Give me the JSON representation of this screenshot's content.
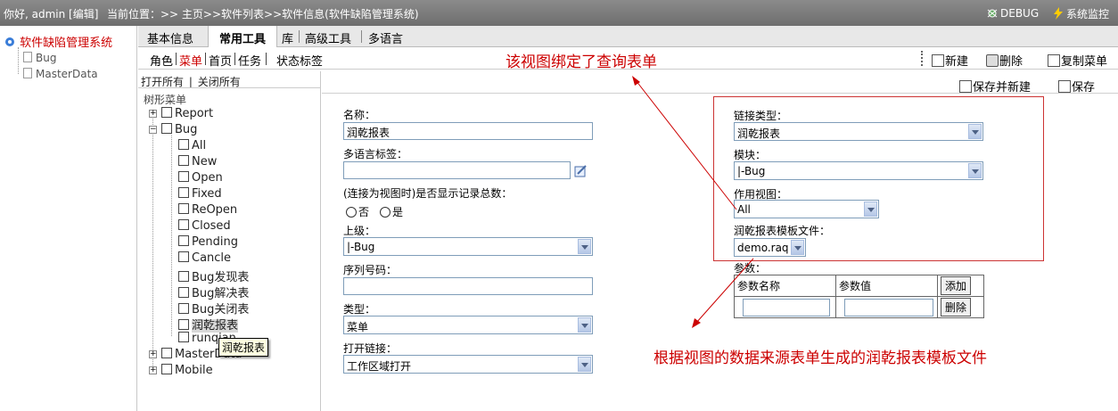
{
  "topbar": {
    "greeting": "你好, admin [编辑]",
    "location": "当前位置：>> 主页>>软件列表>>软件信息(软件缺陷管理系统)",
    "debug": "DEBUG",
    "monitor": "系统监控"
  },
  "leftnav": {
    "root": "软件缺陷管理系统",
    "items": [
      "Bug",
      "MasterData"
    ]
  },
  "tabs": [
    "基本信息",
    "常用工具",
    "库",
    "高级工具",
    "多语言"
  ],
  "subtabs": [
    "角色",
    "菜单",
    "首页",
    "任务",
    "状态标签"
  ],
  "toolbar": {
    "new": "新建",
    "delete": "删除",
    "copy_menu": "复制菜单",
    "save_new": "保存并新建",
    "save": "保存"
  },
  "tree": {
    "open_all": "打开所有",
    "close_all": "关闭所有",
    "title": "树形菜单",
    "nodes": [
      "Report",
      "Bug",
      "MasterData",
      "Mobile"
    ],
    "bug_children": [
      "All",
      "New",
      "Open",
      "Fixed",
      "ReOpen",
      "Closed",
      "Pending",
      "Cancle",
      "Bug发现表",
      "Bug解决表",
      "Bug关闭表",
      "润乾报表",
      "runqian"
    ],
    "tooltip": "润乾报表"
  },
  "form": {
    "name_label": "名称：",
    "name_value": "润乾报表",
    "i18n_label": "多语言标签：",
    "i18n_value": "",
    "show_count_label": "(连接为视图时)是否显示记录总数：",
    "opt_no": "否",
    "opt_yes": "是",
    "parent_label": "上级：",
    "parent_value": "|-Bug",
    "seq_label": "序列号码：",
    "seq_value": "",
    "type_label": "类型：",
    "type_value": "菜单",
    "open_link_label": "打开链接：",
    "open_link_value": "工作区域打开",
    "link_type_label": "链接类型：",
    "link_type_value": "润乾报表",
    "module_label": "模块：",
    "module_value": "|-Bug",
    "view_label": "作用视图：",
    "view_value": "All",
    "template_label": "润乾报表模板文件：",
    "template_value": "demo.raq",
    "params_label": "参数：",
    "param_name_header": "参数名称",
    "param_value_header": "参数值",
    "add_button": "添加",
    "delete_button": "删除"
  },
  "annotations": {
    "top": "该视图绑定了查询表单",
    "bottom": "根据视图的数据来源表单生成的润乾报表模板文件"
  },
  "colors": {
    "accent_red": "#cc0000",
    "topbar": "#7a7a7a"
  }
}
